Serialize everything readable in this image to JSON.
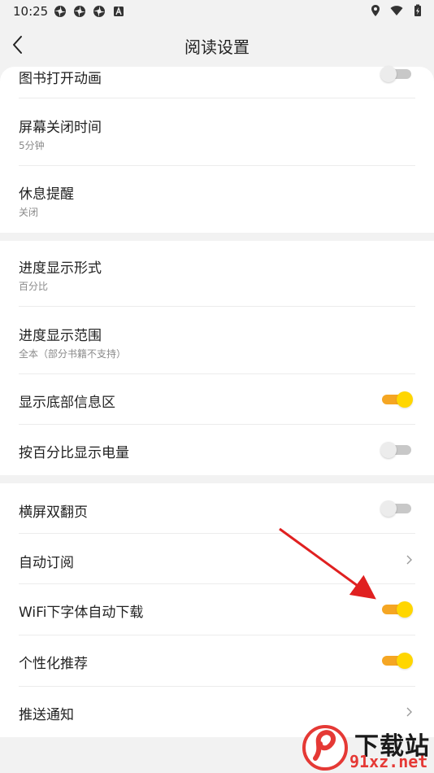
{
  "status_bar": {
    "time": "10:25",
    "left_icons": [
      "app-icon",
      "app-icon",
      "app-icon",
      "notification-a-icon"
    ],
    "right_icons": [
      "location-icon",
      "wifi-icon",
      "battery-icon"
    ]
  },
  "header": {
    "title": "阅读设置"
  },
  "settings": {
    "group1": [
      {
        "label": "图书打开动画",
        "type": "toggle",
        "on": false
      },
      {
        "label": "屏幕关闭时间",
        "sub": "5分钟"
      },
      {
        "label": "休息提醒",
        "sub": "关闭"
      }
    ],
    "group2": [
      {
        "label": "进度显示形式",
        "sub": "百分比"
      },
      {
        "label": "进度显示范围",
        "sub": "全本（部分书籍不支持）"
      },
      {
        "label": "显示底部信息区",
        "type": "toggle",
        "on": true
      },
      {
        "label": "按百分比显示电量",
        "type": "toggle",
        "on": false
      }
    ],
    "group3": [
      {
        "label": "横屏双翻页",
        "type": "toggle",
        "on": false
      },
      {
        "label": "自动订阅",
        "type": "chevron"
      },
      {
        "label": "WiFi下字体自动下载",
        "type": "toggle",
        "on": true
      },
      {
        "label": "个性化推荐",
        "type": "toggle",
        "on": true
      },
      {
        "label": "推送通知",
        "type": "chevron"
      }
    ]
  },
  "colors": {
    "toggle_on_track": "#f5a623",
    "toggle_on_knob": "#ffd600",
    "toggle_off_track": "#c8c8c8",
    "annotation_arrow": "#e02020"
  },
  "watermark": {
    "brand": "下载站",
    "url": "91xz.net"
  }
}
